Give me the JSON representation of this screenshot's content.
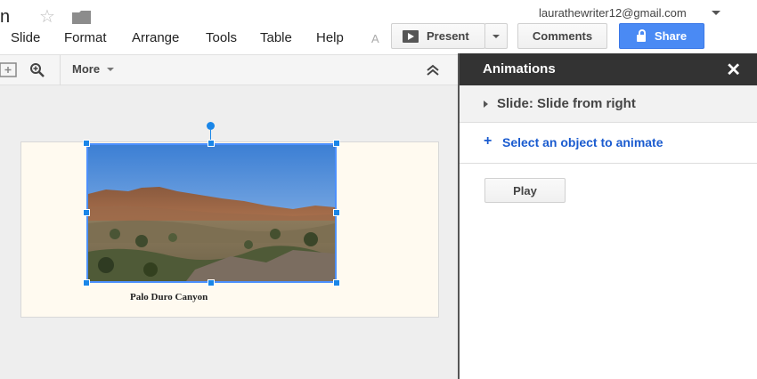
{
  "header": {
    "title_fragment": "n",
    "account_email": "laurathewriter12@gmail.com"
  },
  "menu": {
    "items": [
      "Slide",
      "Format",
      "Arrange",
      "Tools",
      "Table",
      "Help",
      "A"
    ]
  },
  "actions": {
    "present_label": "Present",
    "comments_label": "Comments",
    "share_label": "Share"
  },
  "toolbar": {
    "more_label": "More"
  },
  "slide": {
    "caption": "Palo Duro Canyon"
  },
  "animations_panel": {
    "title": "Animations",
    "close_glyph": "✕",
    "slide_transition": "Slide: Slide from right",
    "select_plus": "+",
    "select_prompt": "Select an object to animate",
    "play_label": "Play"
  },
  "colors": {
    "accent": "#4a8af4",
    "selection": "#1a86e8",
    "link": "#1a5bcf",
    "panel_header": "#333333"
  },
  "icons": [
    "star-icon",
    "folder-icon",
    "present-play-icon",
    "caret-down-icon",
    "lock-icon",
    "new-slide-icon",
    "zoom-icon",
    "collapse-icon",
    "close-icon",
    "triangle-right-icon"
  ]
}
